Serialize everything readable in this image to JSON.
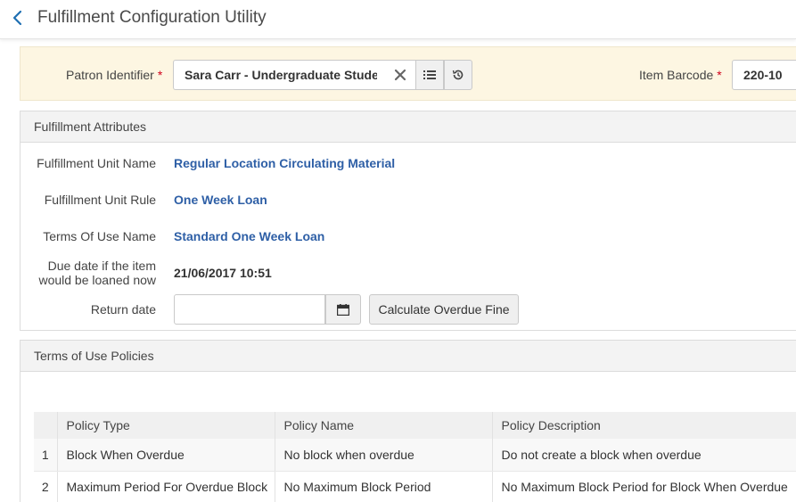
{
  "header": {
    "title": "Fulfillment Configuration Utility"
  },
  "patron_bar": {
    "patron_label": "Patron Identifier",
    "required_mark": "*",
    "patron_value": "Sara Carr  - Undergraduate Student",
    "barcode_label": "Item Barcode",
    "barcode_value": "220-10"
  },
  "attributes": {
    "section_title": "Fulfillment Attributes",
    "unit_name_label": "Fulfillment Unit Name",
    "unit_name_value": "Regular Location Circulating Material",
    "unit_rule_label": "Fulfillment Unit Rule",
    "unit_rule_value": "One Week Loan",
    "terms_label": "Terms Of Use Name",
    "terms_value": "Standard One Week Loan",
    "due_label_line1": "Due date if the item",
    "due_label_line2": "would be loaned now",
    "due_value": "21/06/2017 10:51",
    "return_label": "Return date",
    "return_value": "",
    "calc_button": "Calculate Overdue Fine"
  },
  "policies": {
    "section_title": "Terms of Use Policies",
    "columns": [
      "Policy Type",
      "Policy Name",
      "Policy Description"
    ],
    "rows": [
      {
        "num": "1",
        "type": "Block When Overdue",
        "name": "No block when overdue",
        "description": "Do not create a block when overdue"
      },
      {
        "num": "2",
        "type": "Maximum Period For Overdue Block",
        "name": "No Maximum Block Period",
        "description": "No Maximum Block Period for Block When Overdue"
      }
    ]
  },
  "colors": {
    "link_blue": "#2e5fa6",
    "back_blue": "#1f6fb2",
    "patron_bg": "#fdf6e2",
    "required_red": "#d0021b"
  },
  "icons": [
    "chevron-left-icon",
    "clear-icon",
    "list-icon",
    "history-icon",
    "calendar-icon"
  ]
}
